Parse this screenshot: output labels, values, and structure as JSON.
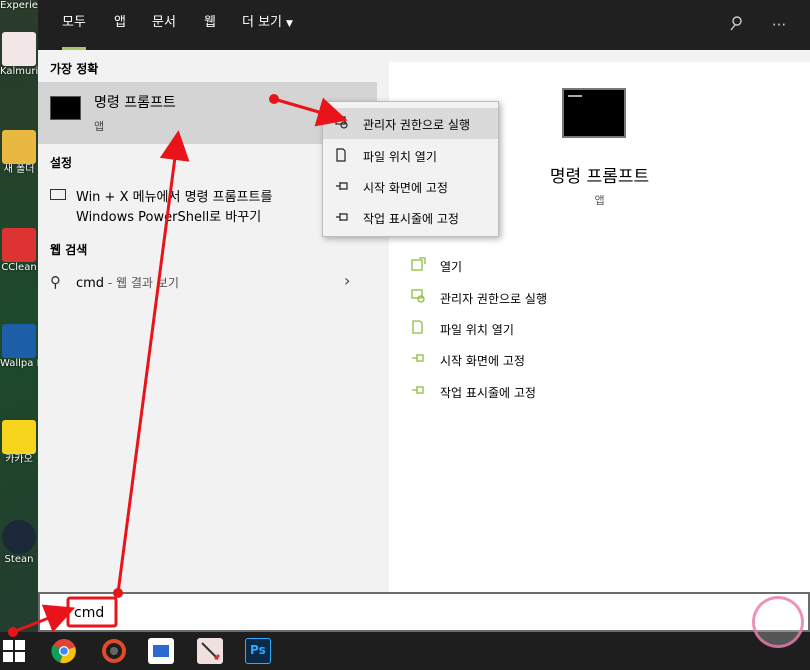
{
  "desktop": {
    "icons": [
      {
        "label": "Experie",
        "color": "#3a4a4a"
      },
      {
        "label": "Kalmuri",
        "color": "#f3e6e6"
      },
      {
        "label": "새 폴더",
        "color": "#3c78c8"
      },
      {
        "label": "CClean",
        "color": "#1a6fcf"
      },
      {
        "label": "Wallpa Engin",
        "color": "#1d5ea8"
      },
      {
        "label": "카카오",
        "color": "#f7d51e"
      },
      {
        "label": "Stean",
        "color": "#1b2838"
      }
    ]
  },
  "tabs": [
    {
      "label": "모두",
      "active": true
    },
    {
      "label": "앱"
    },
    {
      "label": "문서"
    },
    {
      "label": "웹"
    },
    {
      "label": "더 보기"
    }
  ],
  "top_icons": {
    "feedback": "feedback-icon",
    "more": "···"
  },
  "left": {
    "best_match_title": "가장 정확",
    "best_match": {
      "name": "명령 프롬프트",
      "type": "앱"
    },
    "settings_title": "설정",
    "settings_item": {
      "line1": "Win + X 메뉴에서 명령 프롬프트를",
      "line2": "Windows PowerShell로 바꾸기"
    },
    "web_title": "웹 검색",
    "web_item": {
      "query": "cmd",
      "suffix": " - 웹 결과 보기"
    }
  },
  "context_menu": [
    {
      "label": "관리자 권한으로 실행",
      "icon": "shield-icon",
      "hover": true
    },
    {
      "label": "파일 위치 열기",
      "icon": "folder-icon"
    },
    {
      "label": "시작 화면에 고정",
      "icon": "pin-icon"
    },
    {
      "label": "작업 표시줄에 고정",
      "icon": "pin-icon"
    }
  ],
  "detail": {
    "name": "명령 프롬프트",
    "type": "앱",
    "actions": [
      {
        "label": "열기",
        "icon": "open-icon"
      },
      {
        "label": "관리자 권한으로 실행",
        "icon": "shield-icon"
      },
      {
        "label": "파일 위치 열기",
        "icon": "folder-icon"
      },
      {
        "label": "시작 화면에 고정",
        "icon": "pin-icon"
      },
      {
        "label": "작업 표시줄에 고정",
        "icon": "pin-icon"
      }
    ]
  },
  "search": {
    "value": "cmd"
  },
  "taskbar": {
    "apps": [
      {
        "name": "chrome",
        "color": "#ffffff"
      },
      {
        "name": "app-2",
        "color": "#333333"
      },
      {
        "name": "app-3",
        "color": "#2a6bd1"
      },
      {
        "name": "kalmuri",
        "color": "#f0e0e0"
      },
      {
        "name": "Ps",
        "color": "#0b2a47"
      }
    ]
  },
  "colors": {
    "accent": "#a3c96b",
    "annotation": "#e8141a"
  }
}
